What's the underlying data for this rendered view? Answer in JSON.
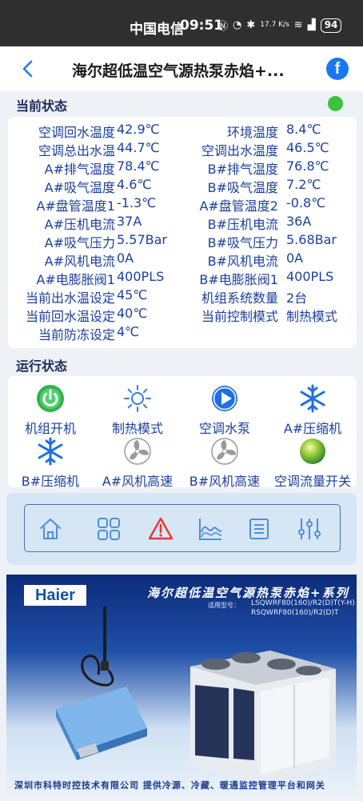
{
  "status_bar": {
    "carrier": "中国电信",
    "time": "09:51",
    "speed": "17.7 K/s",
    "battery": "94"
  },
  "header": {
    "title": "海尔超低温空气源热泵赤焰+...",
    "fb_label": "f"
  },
  "current_status": {
    "title": "当前状态",
    "online_color": "#3cc23c",
    "rows": [
      {
        "l_label": "空调回水温度",
        "l_value": "42.9℃",
        "r_label": "环境温度",
        "r_value": "8.4℃"
      },
      {
        "l_label": "空调总出水温",
        "l_value": "44.7℃",
        "r_label": "空调出水温度",
        "r_value": "46.5℃"
      },
      {
        "l_label": "A#排气温度",
        "l_value": "78.4℃",
        "r_label": "B#排气温度",
        "r_value": "76.8℃"
      },
      {
        "l_label": "A#吸气温度",
        "l_value": "4.6℃",
        "r_label": "B#吸气温度",
        "r_value": "7.2℃"
      },
      {
        "l_label": "A#盘管温度1",
        "l_value": "-1.3℃",
        "r_label": "A#盘管温度2",
        "r_value": "-0.8℃"
      },
      {
        "l_label": "A#压机电流",
        "l_value": "37A",
        "r_label": "B#压机电流",
        "r_value": "36A"
      },
      {
        "l_label": "A#吸气压力",
        "l_value": "5.57Bar",
        "r_label": "B#吸气压力",
        "r_value": "5.68Bar"
      },
      {
        "l_label": "A#风机电流",
        "l_value": "0A",
        "r_label": "B#风机电流",
        "r_value": "0A"
      },
      {
        "l_label": "A#电膨胀阀1",
        "l_value": "400PLS",
        "r_label": "B#电膨胀阀1",
        "r_value": "400PLS"
      },
      {
        "l_label": "当前出水温设定",
        "l_value": "45℃",
        "r_label": "机组系统数量",
        "r_value": "2台"
      },
      {
        "l_label": "当前回水温设定",
        "l_value": "40℃",
        "r_label": "当前控制模式",
        "r_value": "制热模式"
      },
      {
        "l_label": "当前防冻设定",
        "l_value": "4℃",
        "r_label": "",
        "r_value": ""
      }
    ]
  },
  "run_status": {
    "title": "运行状态",
    "items": [
      {
        "label": "机组开机",
        "icon": "power-icon"
      },
      {
        "label": "制热模式",
        "icon": "sun-icon"
      },
      {
        "label": "空调水泵",
        "icon": "pump-play-icon"
      },
      {
        "label": "A#压缩机",
        "icon": "snowflake-icon"
      },
      {
        "label": "B#压缩机",
        "icon": "snowflake-icon"
      },
      {
        "label": "A#风机高速",
        "icon": "fan-icon"
      },
      {
        "label": "B#风机高速",
        "icon": "fan-icon"
      },
      {
        "label": "空调流量开关",
        "icon": "flow-ball-icon"
      }
    ]
  },
  "toolbar": {
    "items": [
      "home-icon",
      "grid-icon",
      "alarm-icon",
      "chart-icon",
      "list-icon",
      "settings-sliders-icon"
    ]
  },
  "banner": {
    "brand": "Haier",
    "title": "海尔超低温空气源热泵赤焰+系列",
    "model_label": "适用型号：",
    "model_1": "LSQWRF80(160)/R2(D)T(Y-H)",
    "model_2": "RSQWRF80(160)/R2(D)T",
    "footer": "深圳市科特时控技术有限公司    提供冷源、冷藏、暖通监控管理平台和网关"
  }
}
